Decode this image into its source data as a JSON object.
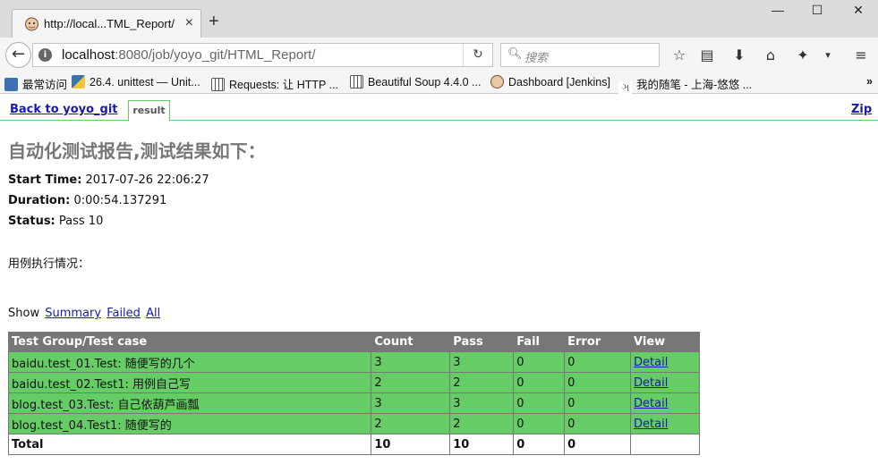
{
  "browser": {
    "tab_title": "http://local...TML_Report/",
    "tab_close": "×",
    "new_tab": "+",
    "window_controls": [
      "—",
      "☐",
      "✕"
    ],
    "url_host": "localhost",
    "url_rest": ":8080/job/yoyo_git/HTML_Report/",
    "search_placeholder": "搜索",
    "bookmarks": [
      {
        "label": "最常访问",
        "icon": "book-icon",
        "color": "#3b6fb6"
      },
      {
        "label": "26.4. unittest — Unit...",
        "icon": "python-icon",
        "color": "#3a74a8"
      },
      {
        "label": "Requests: 让 HTTP ...",
        "icon": "page-icon",
        "color": "#555555"
      },
      {
        "label": "Beautiful Soup 4.4.0 ...",
        "icon": "page-icon",
        "color": "#555555"
      },
      {
        "label": "Dashboard [Jenkins]",
        "icon": "jenkins-icon",
        "color": "#c1543a"
      },
      {
        "label": "我的随笔 - 上海-悠悠 ...",
        "icon": "cnblogs-icon",
        "color": "#666666"
      }
    ],
    "overflow": "»"
  },
  "report": {
    "nav": {
      "back_link": "Back to yoyo_git",
      "tab_label": "result",
      "zip_link": "Zip"
    },
    "heading": "自动化测试报告,测试结果如下：",
    "start_time_label": "Start Time:",
    "start_time": "2017-07-26 22:06:27",
    "duration_label": "Duration:",
    "duration": "0:00:54.137291",
    "status_label": "Status:",
    "status": "Pass 10",
    "description": "用例执行情况：",
    "show_label": "Show",
    "filters": [
      "Summary",
      "Failed",
      "All"
    ],
    "table": {
      "headers": [
        "Test Group/Test case",
        "Count",
        "Pass",
        "Fail",
        "Error",
        "View"
      ],
      "rows": [
        {
          "name": "baidu.test_01.Test: 随便写的几个",
          "count": "3",
          "pass": "3",
          "fail": "0",
          "error": "0",
          "view": "Detail"
        },
        {
          "name": "baidu.test_02.Test1: 用例自己写",
          "count": "2",
          "pass": "2",
          "fail": "0",
          "error": "0",
          "view": "Detail"
        },
        {
          "name": "blog.test_03.Test: 自己依葫芦画瓢",
          "count": "3",
          "pass": "3",
          "fail": "0",
          "error": "0",
          "view": "Detail"
        },
        {
          "name": "blog.test_04.Test1: 随便写的",
          "count": "2",
          "pass": "2",
          "fail": "0",
          "error": "0",
          "view": "Detail"
        }
      ],
      "total": {
        "name": "Total",
        "count": "10",
        "pass": "10",
        "fail": "0",
        "error": "0"
      }
    },
    "colors": {
      "pass": "#66cc66",
      "header": "#777777",
      "link": "#1a1aa6"
    }
  }
}
